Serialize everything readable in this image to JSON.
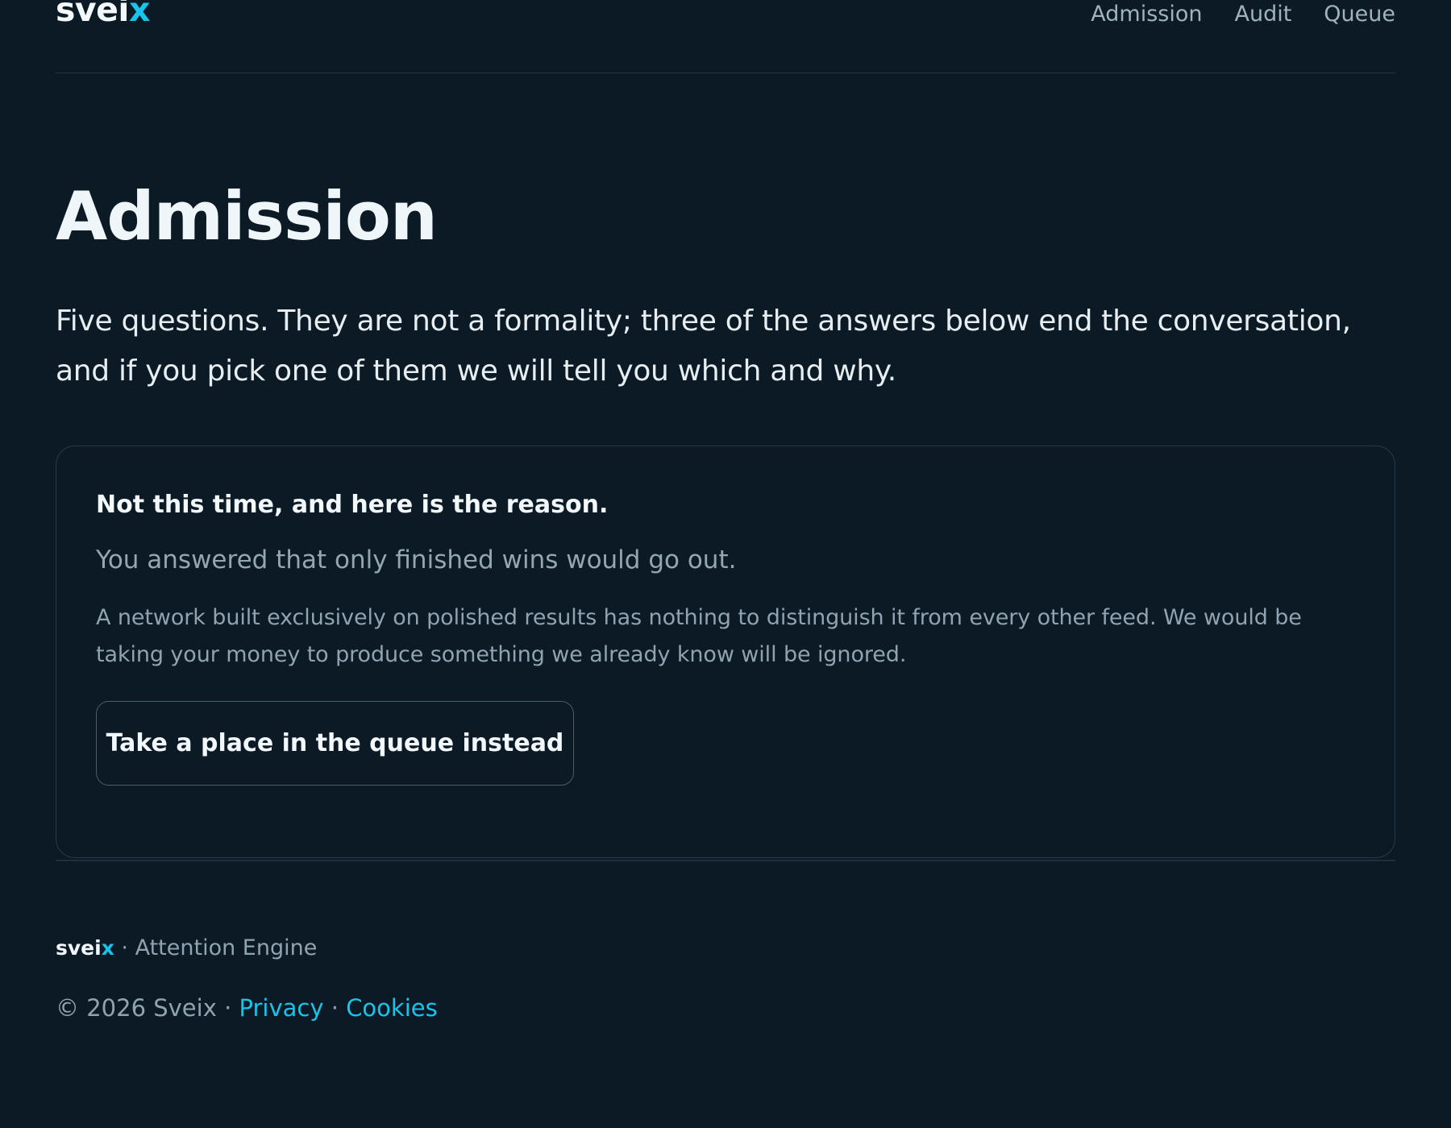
{
  "brand": {
    "logo_main": "svei",
    "logo_accent": "x",
    "accent_color": "#18c3ec"
  },
  "nav": {
    "items": [
      "Admission",
      "Audit",
      "Queue"
    ]
  },
  "page": {
    "title": "Admission",
    "lead": "Five questions. They are not a formality; three of the answers below end the conversation, and if you pick one of them we will tell you which and why."
  },
  "result_card": {
    "title": "Not this time, and here is the reason.",
    "subtitle": "You answered that only finished wins would go out.",
    "body": "A network built exclusively on polished results has nothing to distinguish it from every other feed. We would be taking your money to produce something we already know will be ignored.",
    "button_label": "Take a place in the queue instead"
  },
  "footer": {
    "brand_main": "svei",
    "brand_accent": "x",
    "separator": " · ",
    "tagline": "Attention Engine",
    "copyright": "© 2026 Sveix",
    "privacy_label": "Privacy",
    "cookies_label": "Cookies"
  }
}
